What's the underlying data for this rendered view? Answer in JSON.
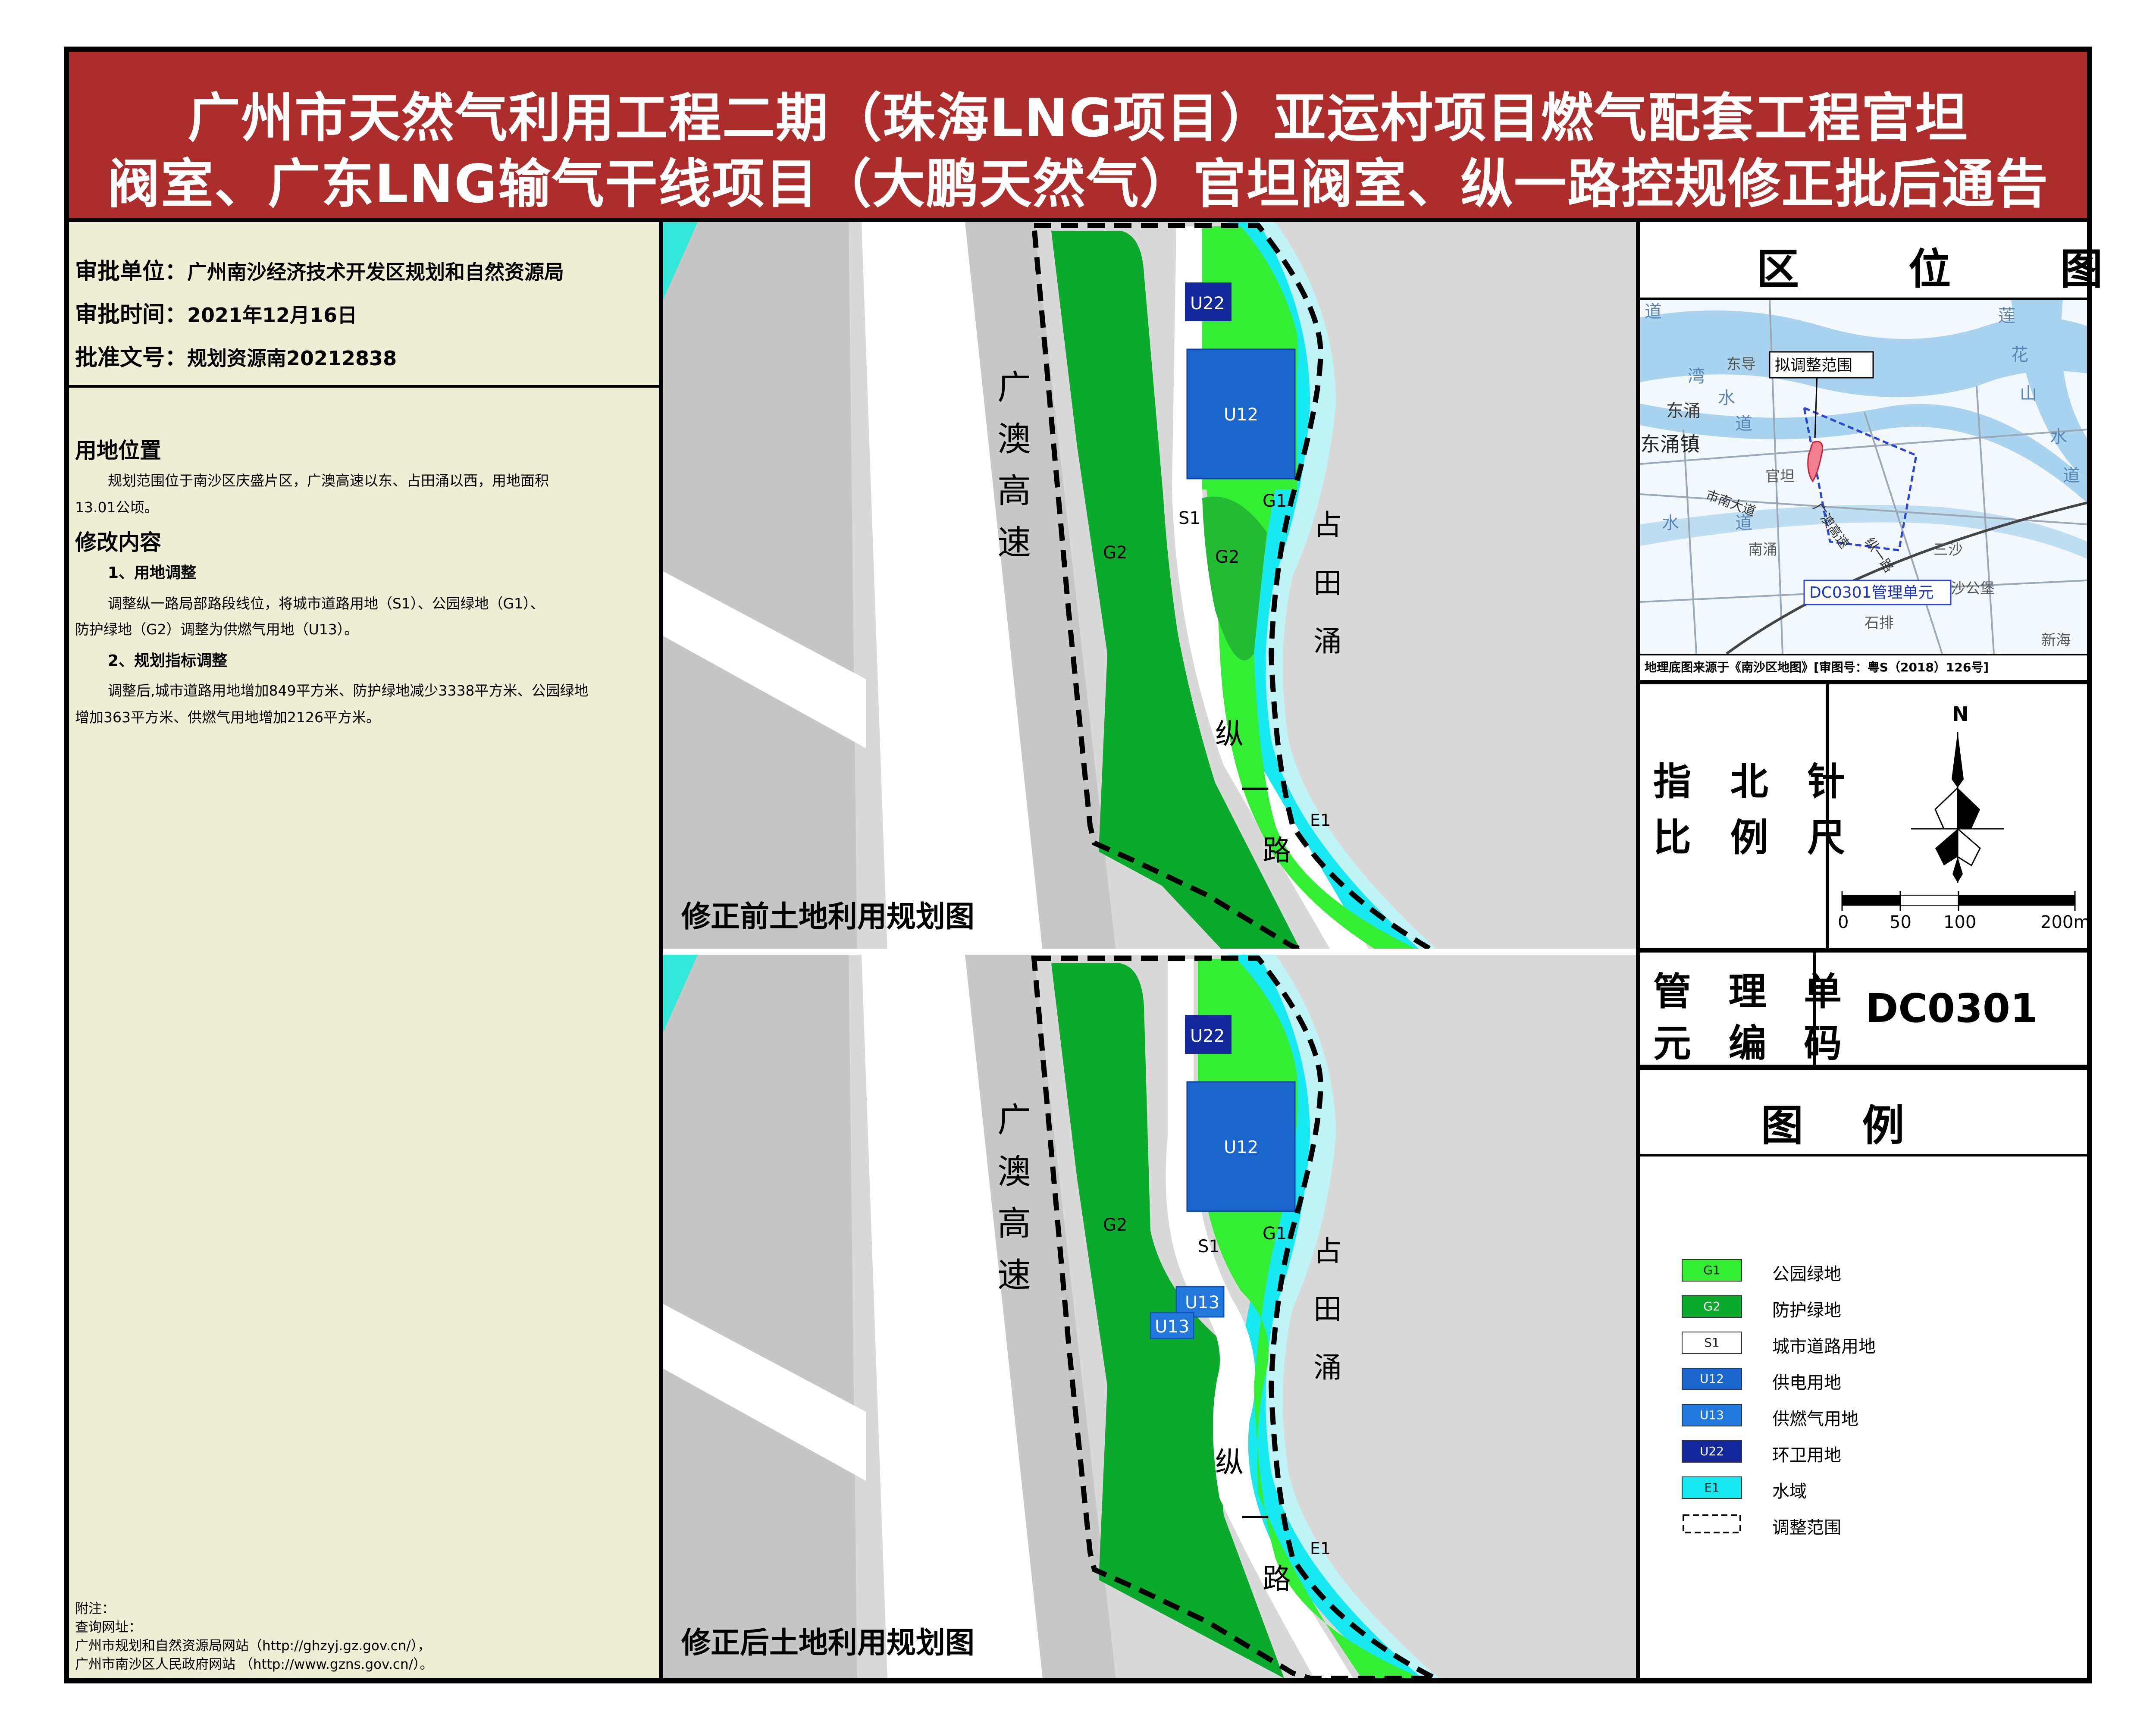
{
  "title": {
    "line1": "广州市天然气利用工程二期（珠海LNG项目）亚运村项目燃气配套工程官坦",
    "line2": "阀室、广东LNG输气干线项目（大鹏天然气）官坦阀室、纵一路控规修正批后通告"
  },
  "approval": {
    "unit_label": "审批单位：",
    "unit_value": "广州南沙经济技术开发区规划和自然资源局",
    "time_label": "审批时间：",
    "time_value": "2021年12月16日",
    "doc_label": "批准文号：",
    "doc_value": "规划资源南20212838"
  },
  "description": {
    "location_heading": "用地位置",
    "location_text_1": "规划范围位于南沙区庆盛片区，广澳高速以东、占田涌以西，用地面积",
    "location_text_2": "13.01公顷。",
    "changes_heading": "修改内容",
    "sub1_heading": "1、用地调整",
    "sub1_text_1": "调整纵一路局部路段线位，将城市道路用地（S1）、公园绿地（G1）、",
    "sub1_text_2": "防护绿地（G2）调整为供燃气用地（U13）。",
    "sub2_heading": "2、规划指标调整",
    "sub2_text_1": "调整后,城市道路用地增加849平方米、防护绿地减少3338平方米、公园绿地",
    "sub2_text_2": "增加363平方米、供燃气用地增加2126平方米。"
  },
  "notes": {
    "line1": "附注：",
    "line2": "查询网址：",
    "line3": "广州市规划和自然资源局网站（http://ghzyj.gz.gov.cn/），",
    "line4": "广州市南沙区人民政府网站  （http://www.gzns.gov.cn/）。"
  },
  "maps": {
    "before_label": "修正前土地利用规划图",
    "after_label": "修正后土地利用规划图",
    "highway_chars": [
      "广",
      "澳",
      "高",
      "速"
    ],
    "creek_chars": [
      "占",
      "田",
      "涌"
    ],
    "road_chars": [
      "纵",
      "一",
      "路"
    ],
    "codes": {
      "g1": "G1",
      "g2": "G2",
      "s1": "S1",
      "u12": "U12",
      "u13": "U13",
      "u22": "U22",
      "e1": "E1"
    }
  },
  "location_map": {
    "title": "区 位 图",
    "callout": "拟调整范围",
    "unit_callout": "DC0301管理单元",
    "source": "地理底图来源于《南沙区地图》[审图号：粤S（2018）126号]",
    "place_names": [
      "东涌镇",
      "东涌",
      "东导",
      "官坦",
      "南涌",
      "三沙",
      "沙公堡",
      "石排",
      "新海",
      "市南大道",
      "广澳高速",
      "纵一路"
    ],
    "water_chars": [
      "道",
      "湾",
      "水",
      "道",
      "水",
      "道",
      "莲",
      "花",
      "山",
      "水",
      "道"
    ]
  },
  "compass": {
    "label_1": "指 北 针",
    "label_2": "比 例 尺",
    "north": "N",
    "scale_ticks": [
      "0",
      "50",
      "100",
      "200m"
    ]
  },
  "unit_code": {
    "label_1": "管 理 单",
    "label_2": "元 编 码",
    "value": "DC0301"
  },
  "legend": {
    "title": "图    例",
    "items": [
      {
        "code": "G1",
        "label": "公园绿地",
        "color": "#33ee33"
      },
      {
        "code": "G2",
        "label": "防护绿地",
        "color": "#0caa2c"
      },
      {
        "code": "S1",
        "label": "城市道路用地",
        "color": "#ffffff"
      },
      {
        "code": "U12",
        "label": "供电用地",
        "color": "#1a66cc"
      },
      {
        "code": "U13",
        "label": "供燃气用地",
        "color": "#2277dd"
      },
      {
        "code": "U22",
        "label": "环卫用地",
        "color": "#14289c"
      },
      {
        "code": "E1",
        "label": "水域",
        "color": "#18e8f0"
      },
      {
        "code": "",
        "label": "调整范围",
        "color": "#000000"
      }
    ]
  },
  "colors": {
    "title_bg": "#ad2c2c",
    "panel_bg": "#eeeed4",
    "park_green": "#33ee33",
    "protect_green": "#0caa2c",
    "water": "#18e8f0",
    "power": "#1a66cc",
    "gas": "#2277dd",
    "sanitation": "#14289c"
  }
}
